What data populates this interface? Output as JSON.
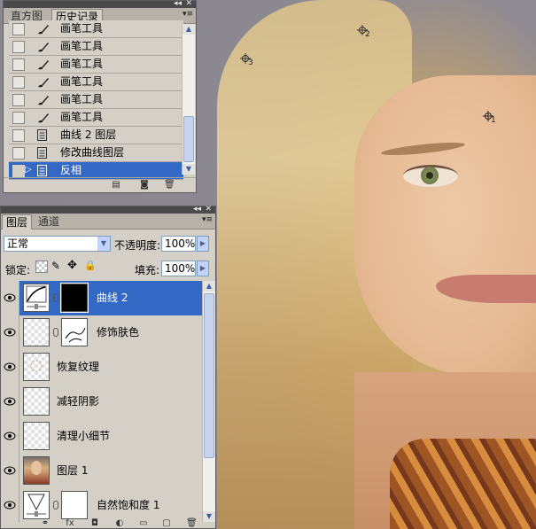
{
  "history_panel": {
    "tabs": [
      {
        "label": "直方图",
        "active": false
      },
      {
        "label": "历史记录",
        "active": true
      }
    ],
    "items": [
      {
        "label": "画笔工具",
        "icon": "brush-icon",
        "selected": false
      },
      {
        "label": "画笔工具",
        "icon": "brush-icon",
        "selected": false
      },
      {
        "label": "画笔工具",
        "icon": "brush-icon",
        "selected": false
      },
      {
        "label": "画笔工具",
        "icon": "brush-icon",
        "selected": false
      },
      {
        "label": "画笔工具",
        "icon": "brush-icon",
        "selected": false
      },
      {
        "label": "画笔工具",
        "icon": "brush-icon",
        "selected": false
      },
      {
        "label": "曲线 2 图层",
        "icon": "document-icon",
        "selected": false
      },
      {
        "label": "修改曲线图层",
        "icon": "document-icon",
        "selected": false
      },
      {
        "label": "反相",
        "icon": "document-icon",
        "selected": true
      }
    ],
    "bottom_icons": [
      "new-document-icon",
      "snapshot-icon",
      "trash-icon"
    ]
  },
  "layers_panel": {
    "tabs": [
      {
        "label": "图层",
        "active": true
      },
      {
        "label": "通道",
        "active": false
      }
    ],
    "blend_mode": "正常",
    "opacity_label": "不透明度:",
    "opacity_value": "100%",
    "lock_label": "锁定:",
    "fill_label": "填充:",
    "fill_value": "100%",
    "layers": [
      {
        "name": "曲线 2",
        "thumb": "curves",
        "mask": "black",
        "selected": true
      },
      {
        "name": "修饰肤色",
        "thumb": "transparent",
        "mask": "white-sketch",
        "selected": false
      },
      {
        "name": "恢复纹理",
        "thumb": "transparent-dots",
        "mask": null,
        "selected": false
      },
      {
        "name": "减轻阴影",
        "thumb": "transparent",
        "mask": null,
        "selected": false
      },
      {
        "name": "清理小细节",
        "thumb": "transparent",
        "mask": null,
        "selected": false
      },
      {
        "name": "图层 1",
        "thumb": "photo",
        "mask": null,
        "selected": false
      },
      {
        "name": "自然饱和度 1",
        "thumb": "vibrance",
        "mask": "white",
        "selected": false
      }
    ]
  },
  "canvas": {
    "color_samplers": [
      {
        "label": "1"
      },
      {
        "label": "2"
      },
      {
        "label": "3"
      }
    ]
  },
  "colors": {
    "selection": "#3468c5",
    "panel_bg": "#d4d0c8",
    "titlebar": "#4a4a4a"
  }
}
